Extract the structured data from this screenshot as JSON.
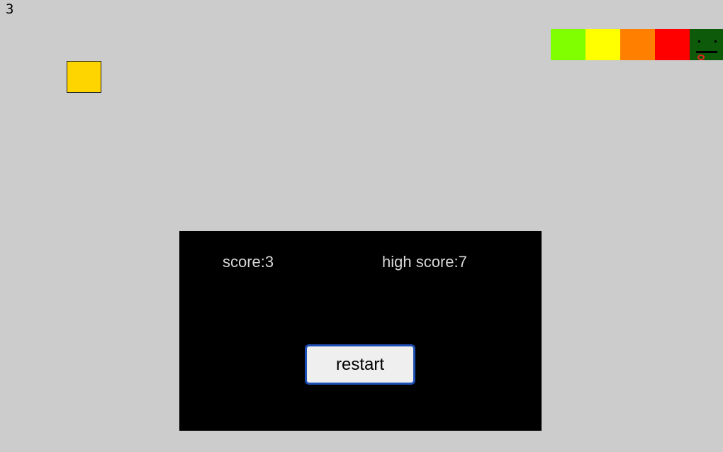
{
  "hud": {
    "score": "3"
  },
  "player": {
    "color": "#ffd500"
  },
  "palette": {
    "swatches": [
      "#7fff00",
      "#ffff00",
      "#ff7f00",
      "#ff0000"
    ],
    "face": {
      "background": "#0e5a0b",
      "feature_color": "#000000",
      "tongue_color": "#e0241b",
      "icon": "face-icon"
    }
  },
  "game_over": {
    "background": "#000000",
    "text_color": "#d8d8d8",
    "score_text": "score:3",
    "high_score_text": "high score:7",
    "restart_label": "restart"
  }
}
